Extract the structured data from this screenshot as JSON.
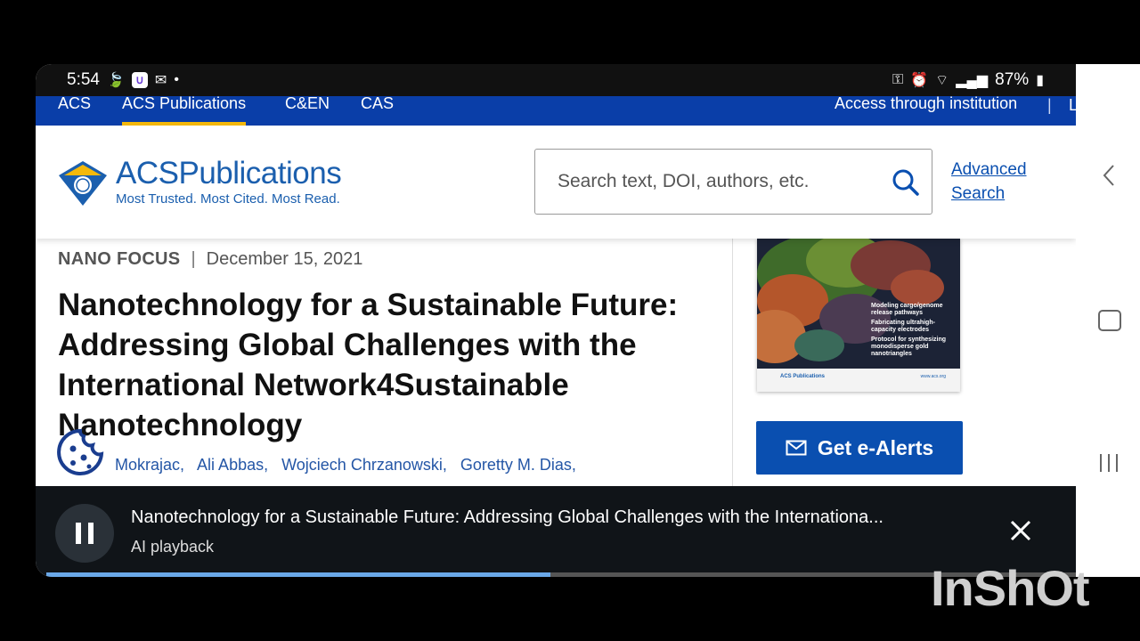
{
  "status_bar": {
    "time": "5:54",
    "battery": "87%"
  },
  "topnav": {
    "items": [
      "ACS",
      "ACS Publications",
      "C&EN",
      "CAS"
    ],
    "active": "ACS Publications",
    "institution": "Access through institution",
    "separator": "|",
    "cut_item": "L"
  },
  "header": {
    "logo_title_a": "ACS",
    "logo_title_b": "Publications",
    "logo_tagline": "Most Trusted. Most Cited. Most Read.",
    "search_placeholder": "Search text, DOI, authors, etc.",
    "advanced_search": "Advanced Search"
  },
  "article": {
    "kind": "NANO FOCUS",
    "separator": "|",
    "date": "December 15, 2021",
    "title": "Nanotechnology for a Sustainable Future: Addressing Global Challenges with the International Network4Sustainable Nanotechnology",
    "authors": [
      "Mokrajac,",
      "Ali Abbas,",
      "Wojciech Chrzanowski,",
      "Goretty M. Dias,"
    ]
  },
  "sidebar": {
    "cover_lines": [
      "Modeling cargo/genome release pathways",
      "Fabricating ultrahigh-capacity electrodes",
      "Protocol for synthesizing monodisperse gold nanotriangles"
    ],
    "cover_logo": "ACS Publications",
    "cover_url": "www.acs.org",
    "ealerts_label": "Get e-Alerts"
  },
  "player": {
    "title": "Nanotechnology for a Sustainable Future: Addressing Global Challenges with the Internationa...",
    "subtitle": "AI playback",
    "progress": 0.49
  },
  "watermark": "InShOt",
  "colors": {
    "acs_blue": "#0a3ea8",
    "accent_gold": "#f5b90a",
    "link_blue": "#0a4fb0"
  }
}
